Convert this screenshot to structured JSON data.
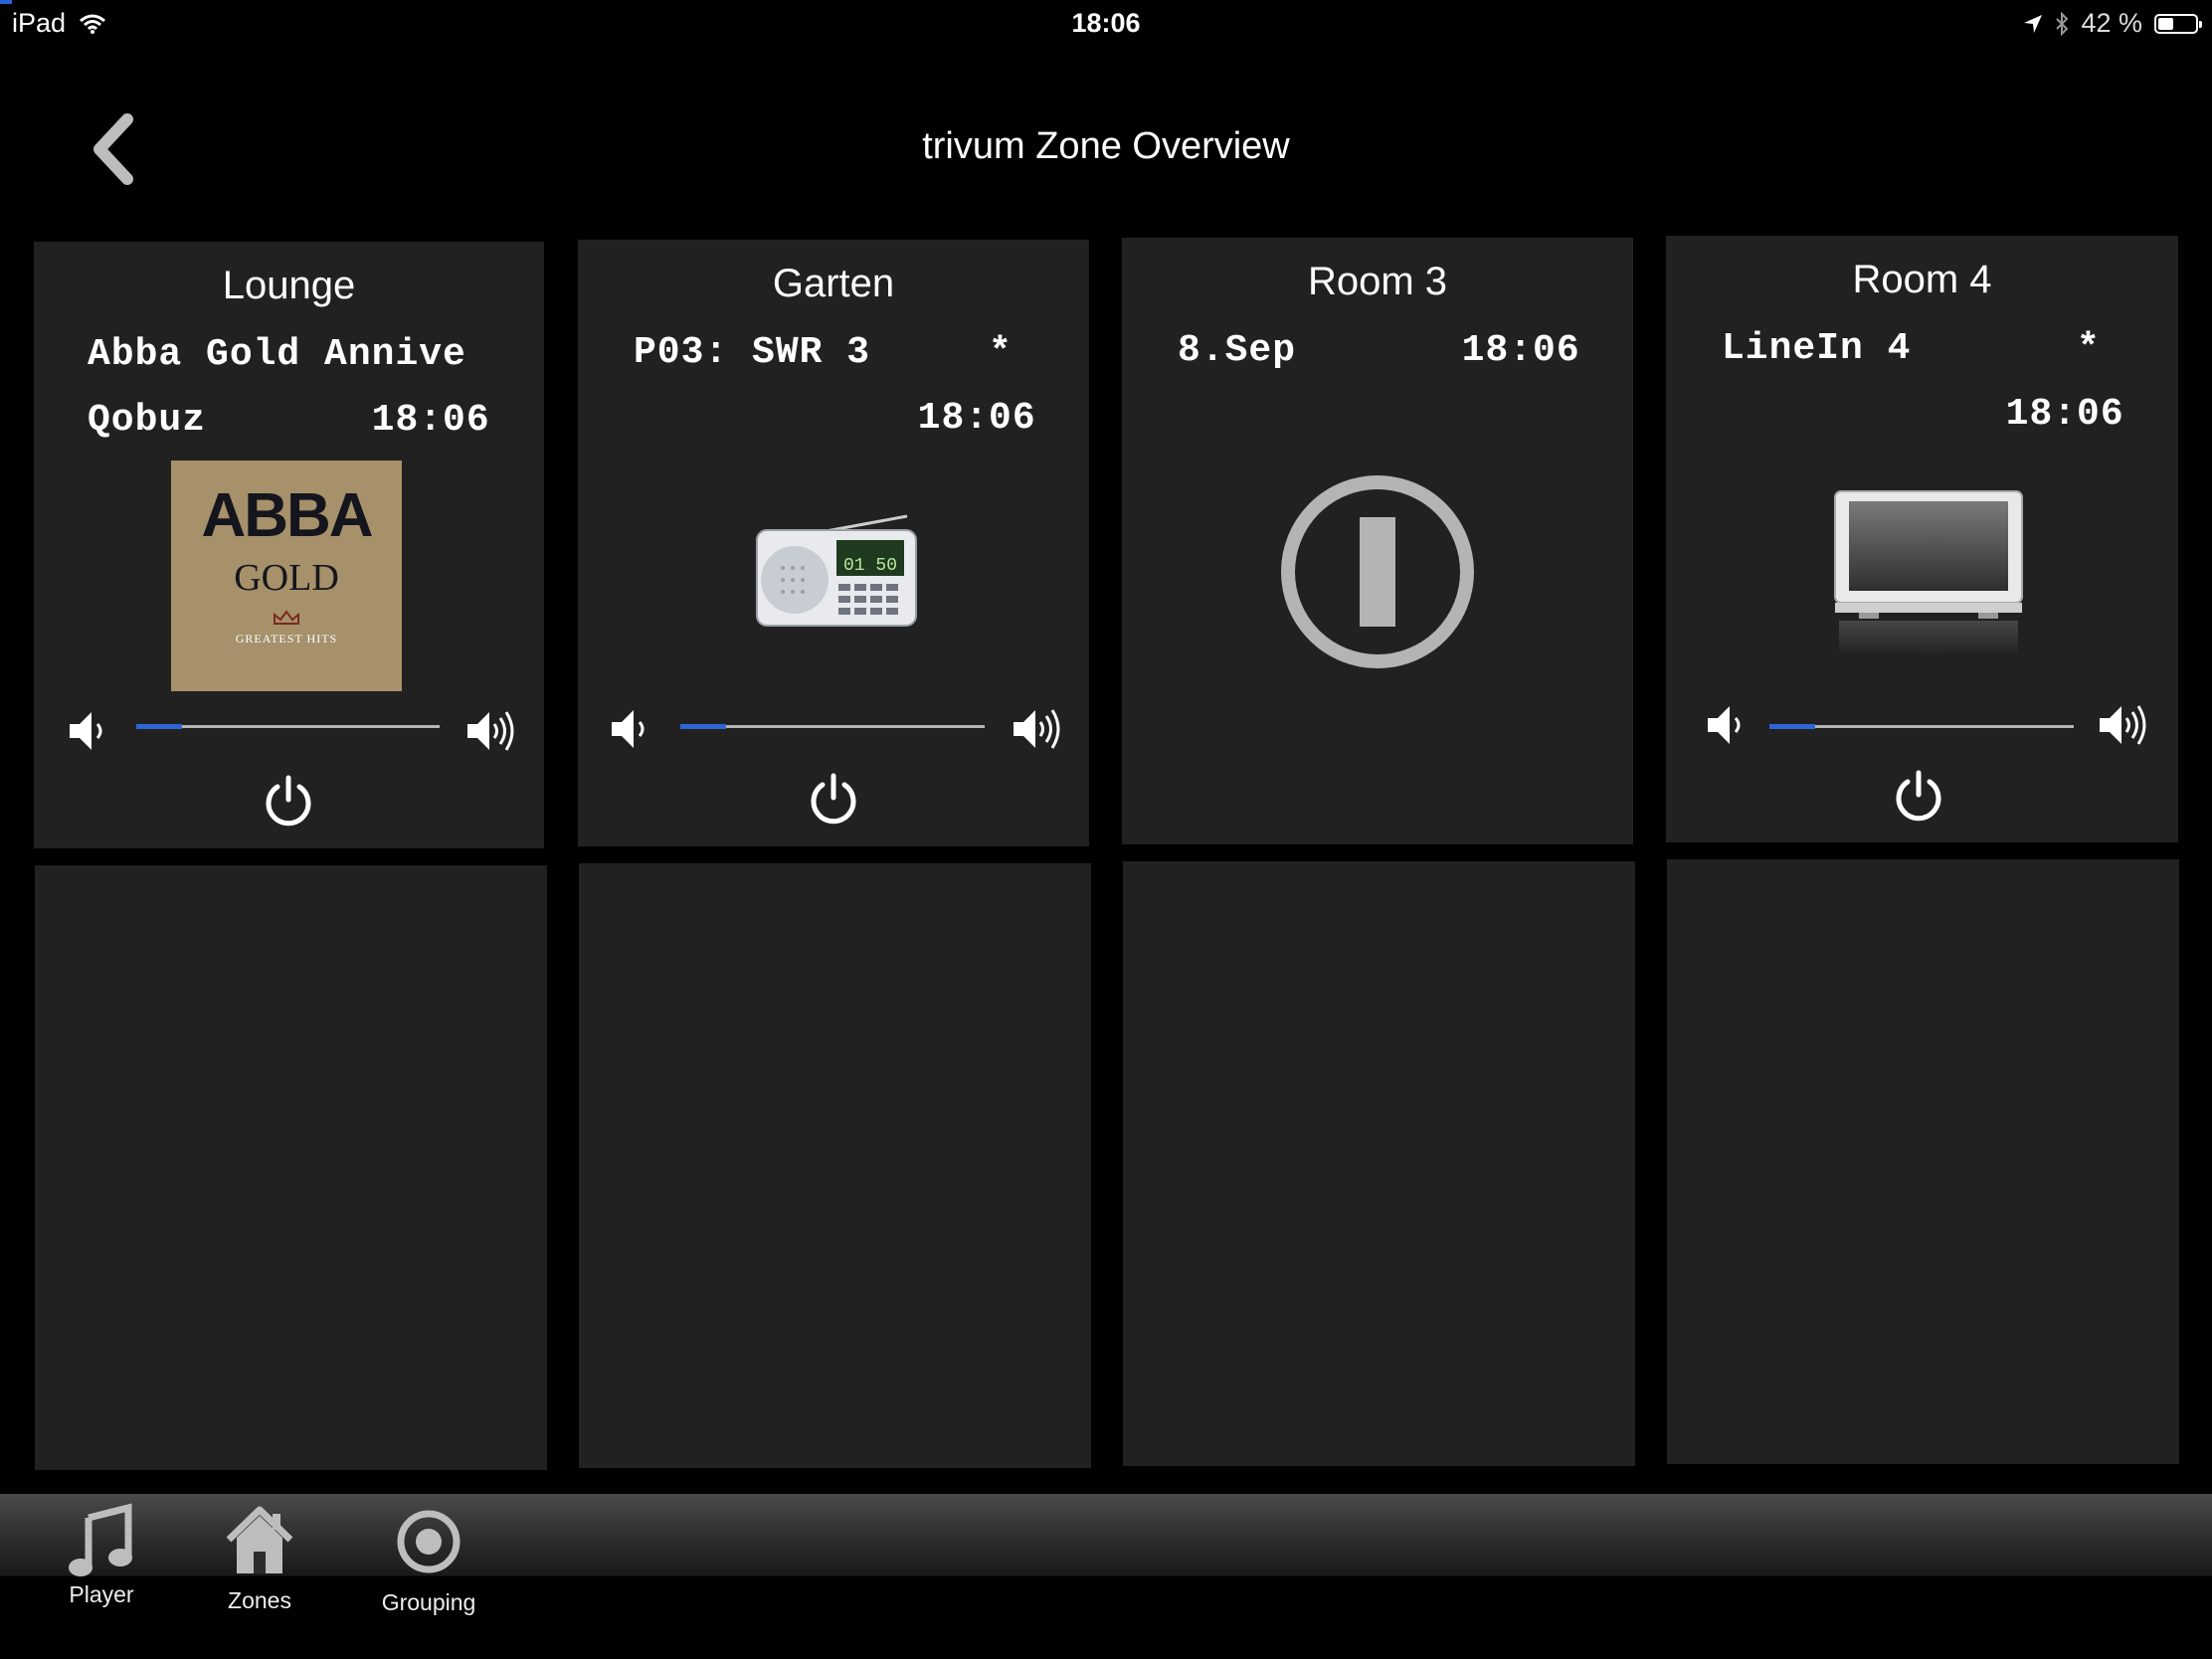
{
  "status_bar": {
    "device": "iPad",
    "time": "18:06",
    "battery": "42 %",
    "battery_level": 0.42
  },
  "header": {
    "title": "trivum Zone Overview"
  },
  "zones": [
    {
      "name": "Lounge",
      "line1": "Abba Gold Annive",
      "line2": "Qobuz       18:06",
      "volume": 0.15,
      "album_art": {
        "band": "ABBA",
        "title": "GOLD",
        "subtitle": "GREATEST HITS"
      }
    },
    {
      "name": "Garten",
      "line1": "P03: SWR 3     *",
      "line2": "            18:06",
      "volume": 0.15,
      "radio_display": "01 50"
    },
    {
      "name": "Room 3",
      "line1": "8.Sep       18:06"
    },
    {
      "name": "Room 4",
      "line1": "LineIn 4       *",
      "line2": "            18:06",
      "volume": 0.15
    }
  ],
  "tabs": [
    {
      "label": "Player",
      "icon": "music-note-icon"
    },
    {
      "label": "Zones",
      "icon": "house-icon"
    },
    {
      "label": "Grouping",
      "icon": "grouping-circle-icon"
    }
  ],
  "colors": {
    "accent": "#2f66d6",
    "tile": "#212121",
    "background": "#000000"
  }
}
